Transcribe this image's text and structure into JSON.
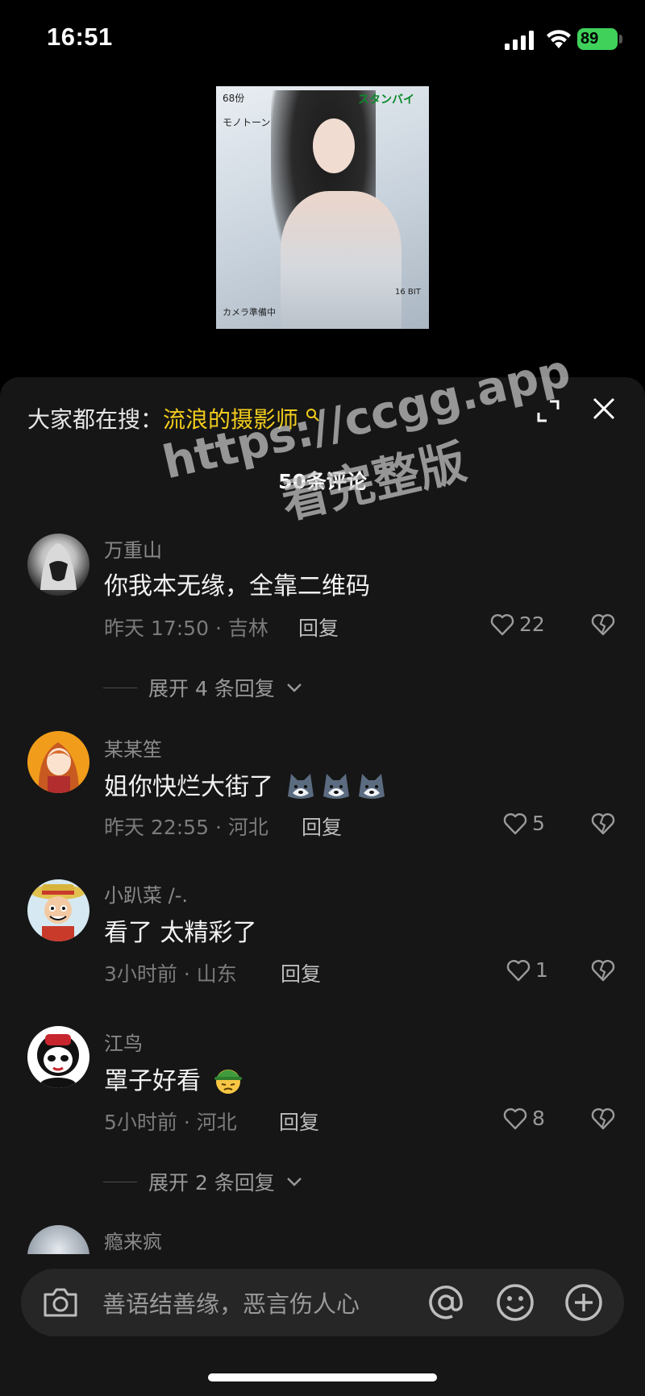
{
  "status_bar": {
    "time": "16:51",
    "battery": "89"
  },
  "video_thumbnail": {
    "top_left_1": "68份",
    "top_left_2": "モノトーン",
    "top_right": "スタンバイ",
    "bottom_left": "カメラ準備中",
    "bottom_right": "16 BIT"
  },
  "panel": {
    "search_prefix": "大家都在搜：",
    "search_term": "流浪的摄影师",
    "comment_count": "50条评论"
  },
  "comments": [
    {
      "user": "万重山",
      "text": "你我本无缘，全靠二维码",
      "meta": "昨天 17:50 · 吉林",
      "reply": "回复",
      "likes": "22",
      "expand": "展开 4 条回复"
    },
    {
      "user": "某某笙",
      "text": "姐你快烂大街了",
      "meta": "昨天 22:55 · 河北",
      "reply": "回复",
      "likes": "5"
    },
    {
      "user": "小趴菜 /-.",
      "text": "看了 太精彩了",
      "meta": "3小时前 · 山东",
      "reply": "回复",
      "likes": "1"
    },
    {
      "user": "江鸟",
      "text": "罩子好看",
      "meta": "5小时前 · 河北",
      "reply": "回复",
      "likes": "8",
      "expand": "展开 2 条回复"
    },
    {
      "user": "瘾来疯"
    }
  ],
  "input": {
    "placeholder": "善语结善缘，恶言伤人心"
  },
  "watermark": {
    "line1": "https://ccgg.app",
    "line2": "看完整版"
  },
  "colors": {
    "accent_yellow": "#f2cc1d",
    "panel_bg": "#161616",
    "battery_green": "#3fd15a"
  }
}
